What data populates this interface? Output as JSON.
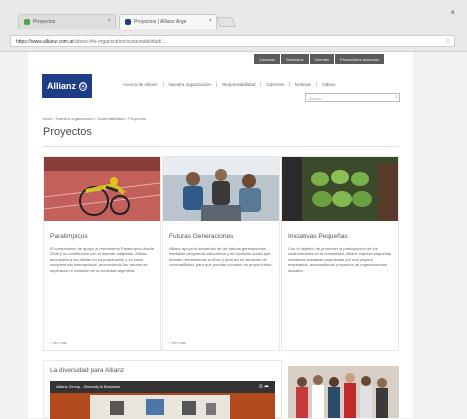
{
  "browser": {
    "tabs": [
      {
        "label": "Proyectos",
        "favicon_color": "#4aa84a"
      },
      {
        "label": "Proyectos | Allianz Arge",
        "favicon_color": "#1d3d86"
      }
    ],
    "close_glyph": "×",
    "back_glyph": "‹",
    "forward_glyph": "›",
    "reload_glyph": "↻",
    "star_glyph": "☆",
    "url_host": "https://www.allianz.com.ar",
    "url_path": "/about-the-organization/sustentabilidad/..."
  },
  "site": {
    "topnav": [
      "Contacto",
      "Siniestros",
      "Clientes",
      "Productores Asesores"
    ],
    "logo_text": "Allianz",
    "logo_mark": "ⓐ",
    "mainnav": [
      "Acerca de Allianz",
      "Nuestra organización",
      "Responsabilidad",
      "Carreras",
      "Noticias",
      "Videos"
    ],
    "search_placeholder": "Buscar",
    "search_glyph": "⌕",
    "breadcrumb": "Inicio › Nuestra organización › Sustentabilidad › Proyectos",
    "page_title": "Proyectos",
    "cards": [
      {
        "title": "Paralímpicos",
        "body": "El compromiso de apoyo al movimiento Paralímpico desde 2006 y la contribución con el deporte adaptado. Allianz acompaña a los atletas en su preparación y en cada competencia internacional, promoviendo los valores de superación e inclusión en la sociedad argentina.",
        "more": "› Ver más"
      },
      {
        "title": "Futuras Generaciones",
        "body": "Allianz apoya el desarrollo de las futuras generaciones mediante programas educativos y de inclusión social que brindan herramientas a niños y jóvenes en situación de vulnerabilidad, para que puedan construir su propio futuro.",
        "more": "› Ver más"
      },
      {
        "title": "Iniciativas Pequeñas",
        "body": "Con el objetivo de promover la participación de los colaboradores en la comunidad, Allianz impulsa pequeñas iniciativas solidarias propuestas por sus propios empleados, acompañando proyectos de organizaciones sociales.",
        "more": ""
      }
    ],
    "diversity_title": "La diversidad para Allianz",
    "video_title": "Allianz Group - Diversity is Business",
    "video_icons": "⏲ ➦"
  }
}
